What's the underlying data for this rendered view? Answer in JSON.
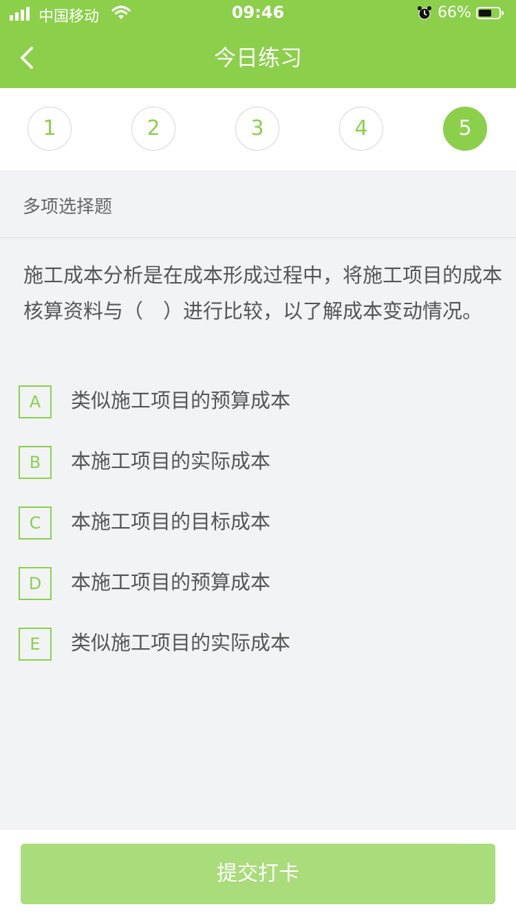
{
  "status_bar": {
    "carrier": "中国移动",
    "time": "09:46",
    "battery_percent": "66%",
    "battery_level": 0.66,
    "icons": [
      "signal-icon",
      "wifi-icon",
      "alarm-icon",
      "battery-icon"
    ]
  },
  "header": {
    "title": "今日练习",
    "back_icon": "chevron-left-icon"
  },
  "question_nav": {
    "items": [
      "1",
      "2",
      "3",
      "4",
      "5"
    ],
    "active_index": 4
  },
  "question": {
    "type": "多项选择题",
    "text": "施工成本分析是在成本形成过程中，将施工项目的成本核算资料与（　）进行比较，以了解成本变动情况。",
    "options": [
      {
        "key": "A",
        "text": "类似施工项目的预算成本"
      },
      {
        "key": "B",
        "text": "本施工项目的实际成本"
      },
      {
        "key": "C",
        "text": "本施工项目的目标成本"
      },
      {
        "key": "D",
        "text": "本施工项目的预算成本"
      },
      {
        "key": "E",
        "text": "类似施工项目的实际成本"
      }
    ]
  },
  "footer": {
    "submit_label": "提交打卡"
  },
  "colors": {
    "brand_green": "#8bcf4b",
    "button_green_disabled": "#a9dc7a",
    "background": "#f2f3f5"
  }
}
